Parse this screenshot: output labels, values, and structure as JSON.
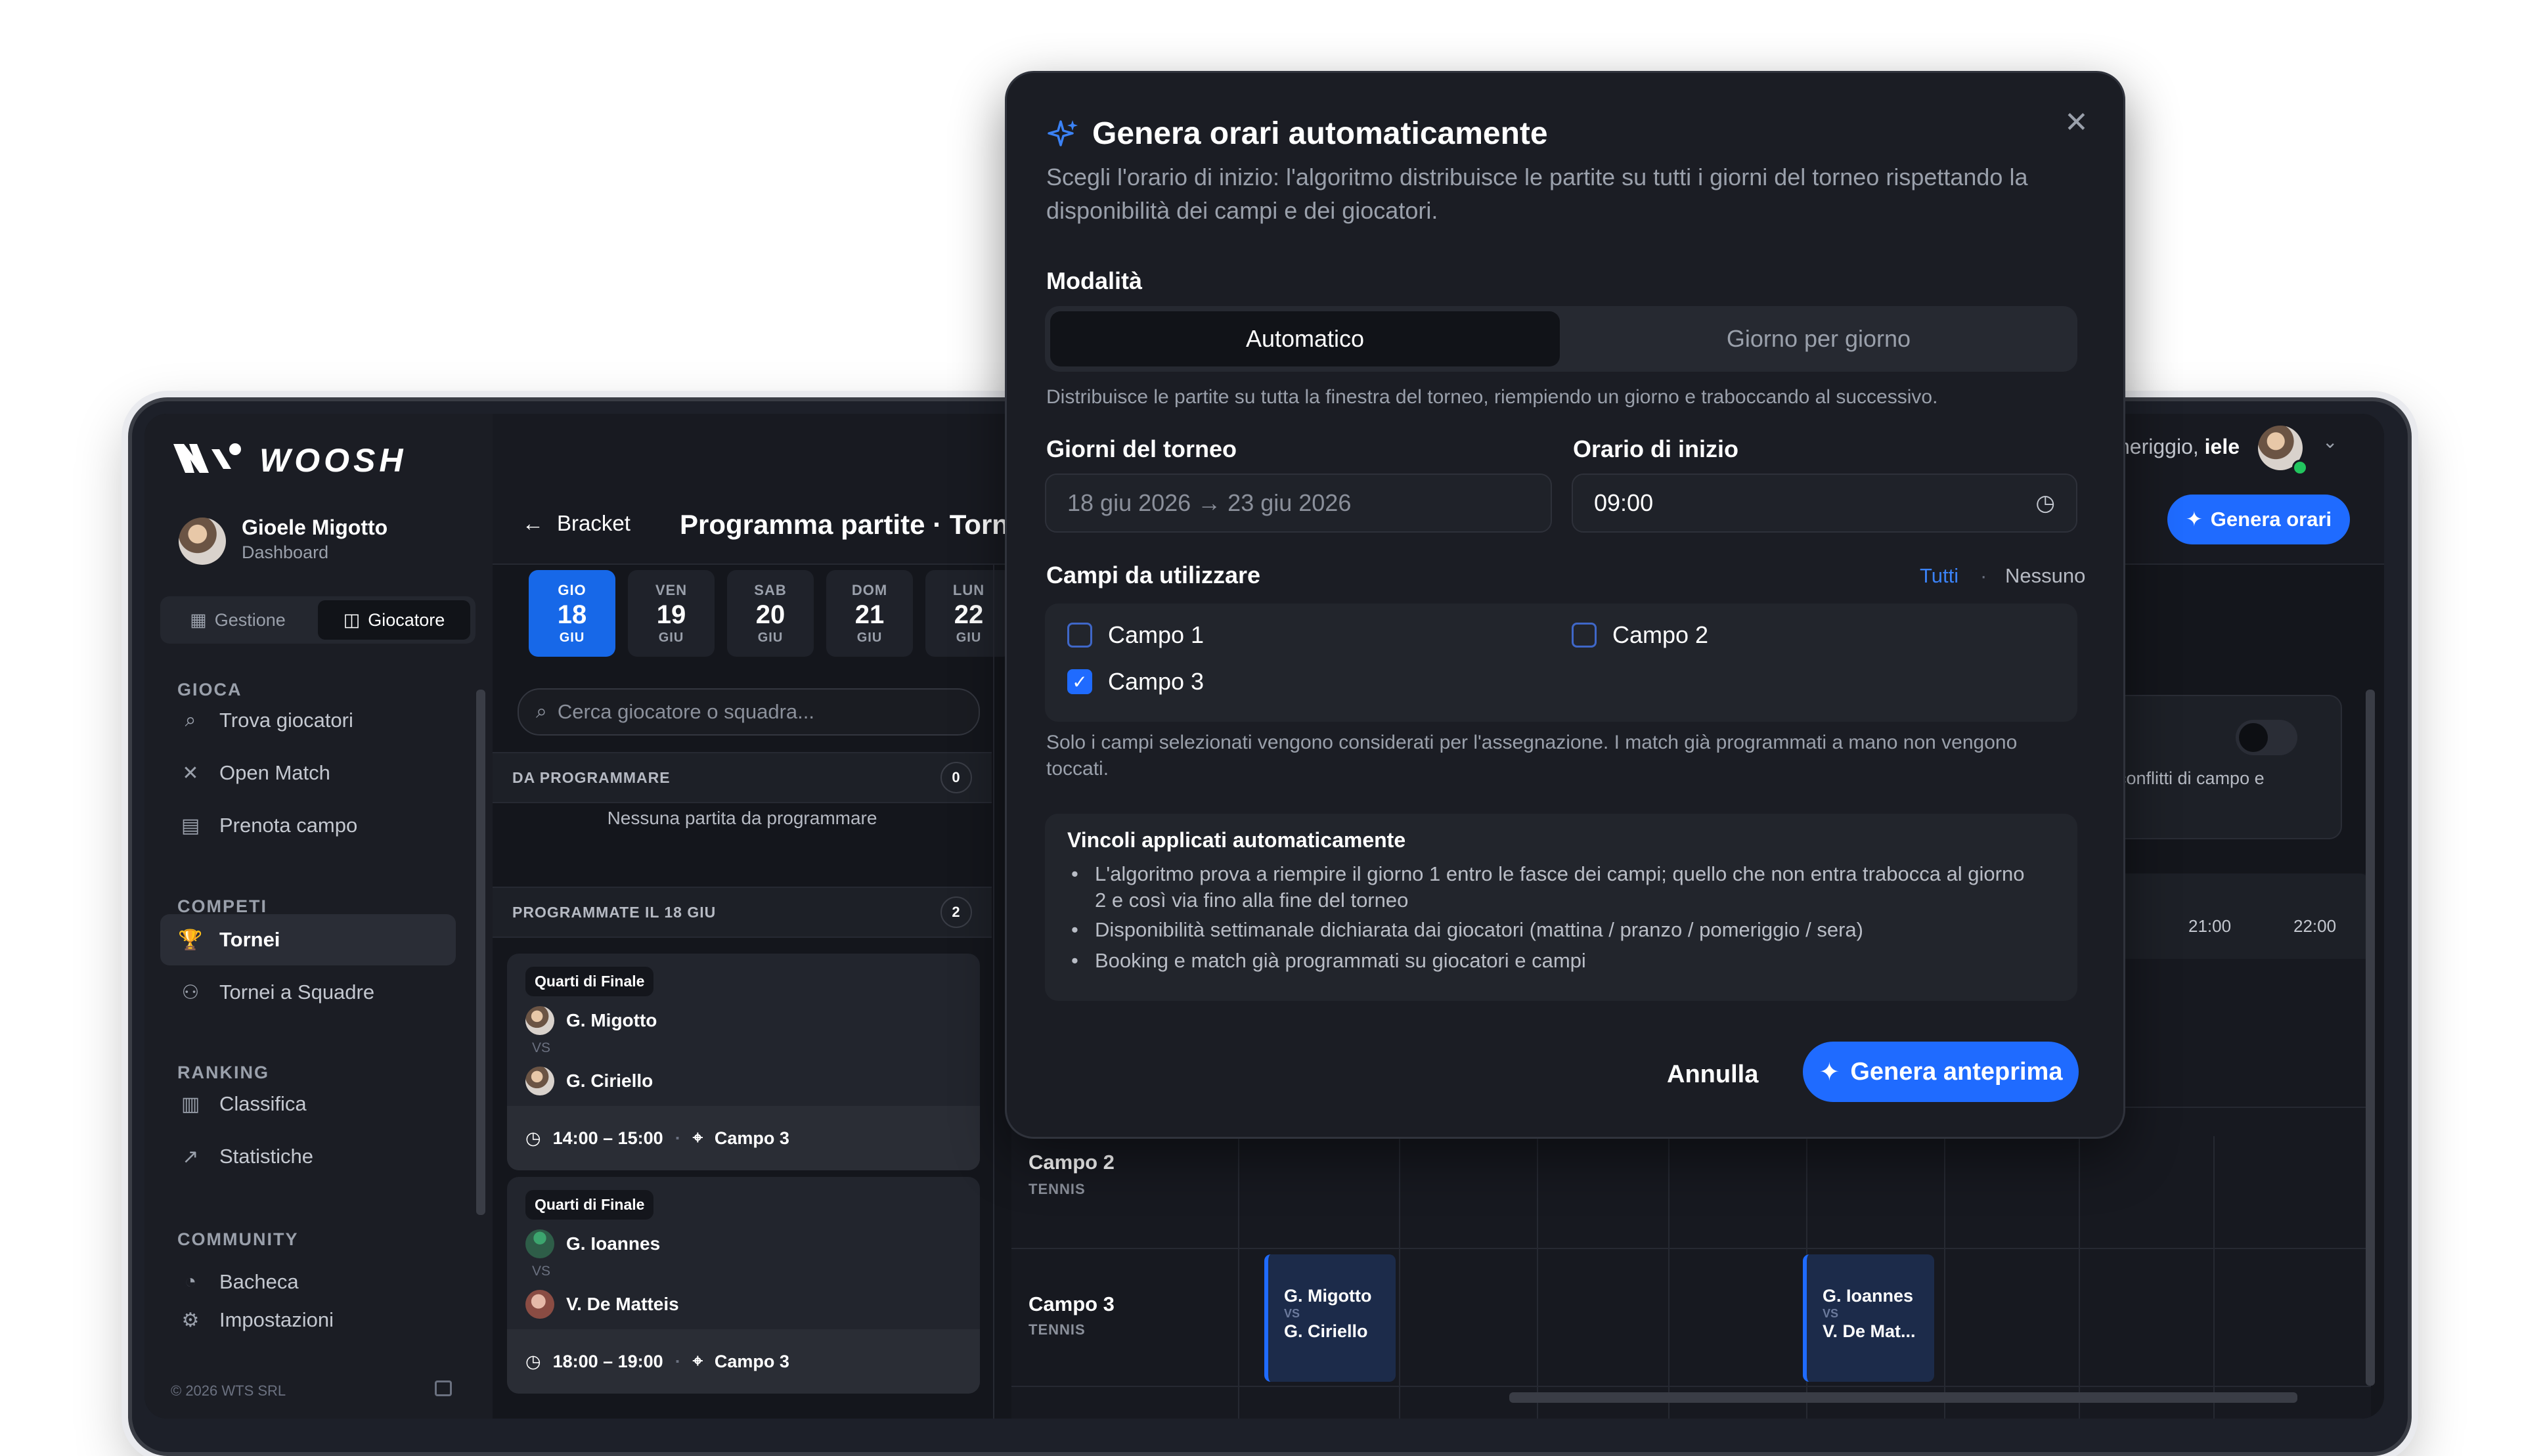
{
  "brand": {
    "name": "WOOSH"
  },
  "user": {
    "name": "Gioele Migotto",
    "subtitle": "Dashboard",
    "greeting": "neriggio,",
    "greeting_name": "iele"
  },
  "sidebar": {
    "modes": [
      {
        "label": "Gestione"
      },
      {
        "label": "Giocatore"
      }
    ],
    "sections": [
      {
        "title": "GIOCA",
        "items": [
          "Trova giocatori",
          "Open Match",
          "Prenota campo"
        ]
      },
      {
        "title": "COMPETI",
        "items": [
          "Tornei",
          "Tornei a Squadre"
        ]
      },
      {
        "title": "RANKING",
        "items": [
          "Classifica",
          "Statistiche"
        ]
      },
      {
        "title": "COMMUNITY",
        "items": [
          "Bacheca",
          "Impostazioni"
        ]
      }
    ],
    "footer": "© 2026 WTS SRL"
  },
  "header": {
    "back_label": "Bracket",
    "title": "Programma partite · Torneo",
    "generate_label": "Genera orari"
  },
  "days": [
    {
      "name": "GIO",
      "num": "18",
      "month": "GIU"
    },
    {
      "name": "VEN",
      "num": "19",
      "month": "GIU"
    },
    {
      "name": "SAB",
      "num": "20",
      "month": "GIU"
    },
    {
      "name": "DOM",
      "num": "21",
      "month": "GIU"
    },
    {
      "name": "LUN",
      "num": "22",
      "month": "GIU"
    }
  ],
  "search": {
    "placeholder": "Cerca giocatore o squadra..."
  },
  "unscheduled": {
    "title": "DA PROGRAMMARE",
    "count": "0",
    "empty": "Nessuna partita da programmare"
  },
  "scheduled": {
    "title": "PROGRAMMATE IL 18 GIU",
    "count": "2"
  },
  "matches": [
    {
      "round": "Quarti di Finale",
      "p1": "G. Migotto",
      "vs": "VS",
      "p2": "G. Ciriello",
      "time": "14:00 – 15:00",
      "court": "Campo 3"
    },
    {
      "round": "Quarti di Finale",
      "p1": "G. Ioannes",
      "vs": "VS",
      "p2": "V. De Matteis",
      "time": "18:00 – 19:00",
      "court": "Campo 3"
    }
  ],
  "right": {
    "conflicts_text": "conflitti di campo e",
    "times": [
      "21:00",
      "22:00"
    ],
    "courts": [
      {
        "name": "Campo 2",
        "sport": "TENNIS"
      },
      {
        "name": "Campo 3",
        "sport": "TENNIS"
      }
    ],
    "events": [
      {
        "p1": "G. Migotto",
        "vs": "VS",
        "p2": "G. Ciriello"
      },
      {
        "p1": "G. Ioannes",
        "vs": "VS",
        "p2": "V. De Mat..."
      }
    ]
  },
  "modal": {
    "title": "Genera orari automaticamente",
    "description": "Scegli l'orario di inizio: l'algoritmo distribuisce le partite su tutti i giorni del torneo rispettando la disponibilità dei campi e dei giocatori.",
    "mode_label": "Modalità",
    "tabs": [
      "Automatico",
      "Giorno per giorno"
    ],
    "mode_hint": "Distribuisce le partite su tutta la finestra del torneo, riempiendo un giorno e traboccando al successivo.",
    "days_label": "Giorni del torneo",
    "days_value": "18 giu 2026 → 23 giu 2026",
    "start_label": "Orario di inizio",
    "start_value": "09:00",
    "courts_label": "Campi da utilizzare",
    "all_label": "Tutti",
    "sep": "·",
    "none_label": "Nessuno",
    "courts": [
      {
        "label": "Campo 1",
        "checked": false
      },
      {
        "label": "Campo 2",
        "checked": false
      },
      {
        "label": "Campo 3",
        "checked": true
      }
    ],
    "courts_hint": "Solo i campi selezionati vengono considerati per l'assegnazione. I match già programmati a mano non vengono toccati.",
    "rules_title": "Vincoli applicati automaticamente",
    "rules": [
      "L'algoritmo prova a riempire il giorno 1 entro le fasce dei campi; quello che non entra trabocca al giorno 2 e così via fino alla fine del torneo",
      "Disponibilità settimanale dichiarata dai giocatori (mattina / pranzo / pomeriggio / sera)",
      "Booking e match già programmati su giocatori e campi"
    ],
    "cancel_label": "Annulla",
    "confirm_label": "Genera anteprima"
  },
  "colors": {
    "accent": "#1f6bff",
    "panel": "#1b1d24",
    "background": "#14161c"
  }
}
